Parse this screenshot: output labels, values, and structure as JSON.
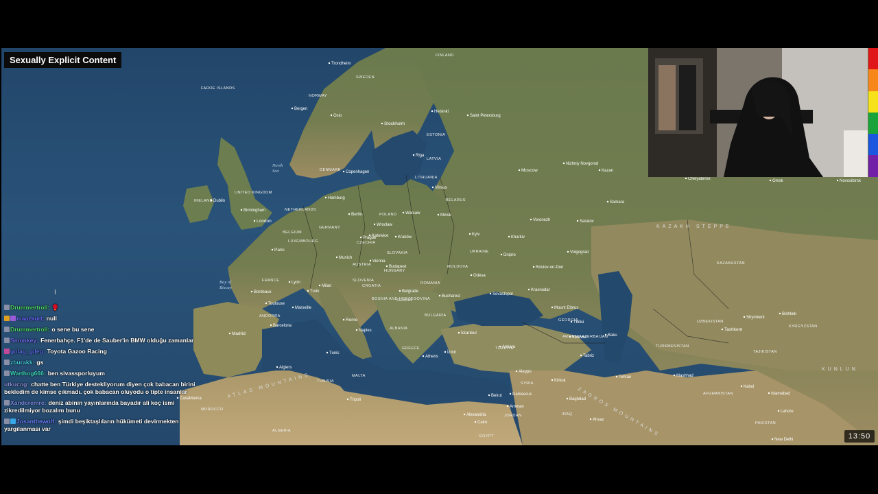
{
  "overlay": {
    "warning_label": "Sexually Explicit Content"
  },
  "clock": "13:50",
  "map": {
    "cities": [
      {
        "id": "trondheim",
        "name": "Trondheim"
      },
      {
        "id": "bergen",
        "name": "Bergen"
      },
      {
        "id": "oslo",
        "name": "Oslo"
      },
      {
        "id": "stockholm",
        "name": "Stockholm"
      },
      {
        "id": "helsinki",
        "name": "Helsinki"
      },
      {
        "id": "stpetersburg",
        "name": "Saint Petersburg"
      },
      {
        "id": "copenhagen",
        "name": "Copenhagen"
      },
      {
        "id": "riga",
        "name": "Riga"
      },
      {
        "id": "vilnius",
        "name": "Vilnius"
      },
      {
        "id": "moscow",
        "name": "Moscow"
      },
      {
        "id": "nizhny",
        "name": "Nizhniy Novgorod"
      },
      {
        "id": "kazan",
        "name": "Kazan"
      },
      {
        "id": "samara",
        "name": "Samara"
      },
      {
        "id": "saratov",
        "name": "Saratov"
      },
      {
        "id": "voronezh",
        "name": "Voronezh"
      },
      {
        "id": "kharkiv",
        "name": "Kharkiv"
      },
      {
        "id": "kyiv",
        "name": "Kyiv"
      },
      {
        "id": "dnipro",
        "name": "Dnipro"
      },
      {
        "id": "volgograd",
        "name": "Volgograd"
      },
      {
        "id": "rostov",
        "name": "Rostov-on-Don"
      },
      {
        "id": "odesa",
        "name": "Odesa"
      },
      {
        "id": "krasnodar",
        "name": "Krasnodar"
      },
      {
        "id": "sevastopol",
        "name": "Sevastopol"
      },
      {
        "id": "minsk",
        "name": "Minsk"
      },
      {
        "id": "warsaw",
        "name": "Warsaw"
      },
      {
        "id": "wroclaw",
        "name": "Wroclaw"
      },
      {
        "id": "krakow",
        "name": "Kraków"
      },
      {
        "id": "katowice",
        "name": "Katowice"
      },
      {
        "id": "berlin",
        "name": "Berlin"
      },
      {
        "id": "hamburg",
        "name": "Hamburg"
      },
      {
        "id": "prague",
        "name": "Prague"
      },
      {
        "id": "munich",
        "name": "Munich"
      },
      {
        "id": "vienna",
        "name": "Vienna"
      },
      {
        "id": "budapest",
        "name": "Budapest"
      },
      {
        "id": "belgrade",
        "name": "Belgrade"
      },
      {
        "id": "bucharest",
        "name": "Bucharest"
      },
      {
        "id": "milan",
        "name": "Milan"
      },
      {
        "id": "turin",
        "name": "Turin"
      },
      {
        "id": "rome",
        "name": "Rome"
      },
      {
        "id": "naples",
        "name": "Naples"
      },
      {
        "id": "marseille",
        "name": "Marseille"
      },
      {
        "id": "lyon",
        "name": "Lyon"
      },
      {
        "id": "paris",
        "name": "Paris"
      },
      {
        "id": "bordeaux",
        "name": "Bordeaux"
      },
      {
        "id": "toulouse",
        "name": "Toulouse"
      },
      {
        "id": "london",
        "name": "London"
      },
      {
        "id": "birmingham",
        "name": "Birmingham"
      },
      {
        "id": "dublin",
        "name": "Dublin"
      },
      {
        "id": "madrid",
        "name": "Madrid"
      },
      {
        "id": "barcelona",
        "name": "Barcelona"
      },
      {
        "id": "algiers",
        "name": "Algiers"
      },
      {
        "id": "tunis",
        "name": "Tunis"
      },
      {
        "id": "tripoli",
        "name": "Tripoli"
      },
      {
        "id": "casablanca",
        "name": "Casablanca"
      },
      {
        "id": "athens",
        "name": "Athens"
      },
      {
        "id": "izmir",
        "name": "İzmir"
      },
      {
        "id": "istanbul",
        "name": "İstanbul"
      },
      {
        "id": "ankara",
        "name": "Ankara"
      },
      {
        "id": "aleppo",
        "name": "Aleppo"
      },
      {
        "id": "damascus",
        "name": "Damascus"
      },
      {
        "id": "beirut",
        "name": "Beirut"
      },
      {
        "id": "amman",
        "name": "Amman"
      },
      {
        "id": "baghdad",
        "name": "Baghdad"
      },
      {
        "id": "cairo",
        "name": "Cairo"
      },
      {
        "id": "alexandria",
        "name": "Alexandria"
      },
      {
        "id": "tehran",
        "name": "Tehran"
      },
      {
        "id": "tabriz",
        "name": "Tabriz"
      },
      {
        "id": "baku",
        "name": "Baku"
      },
      {
        "id": "tbilisi",
        "name": "Tbilisi"
      },
      {
        "id": "yerevan",
        "name": "Yerevan"
      },
      {
        "id": "mashhad",
        "name": "Mashhad"
      },
      {
        "id": "tashkent",
        "name": "Tashkent"
      },
      {
        "id": "bishkek",
        "name": "Bishkek"
      },
      {
        "id": "shymkent",
        "name": "Shymkent"
      },
      {
        "id": "kabul",
        "name": "Kabul"
      },
      {
        "id": "islamabad",
        "name": "Islamabad"
      },
      {
        "id": "lahore",
        "name": "Lahore"
      },
      {
        "id": "newdelhi",
        "name": "New Delhi"
      },
      {
        "id": "omsk",
        "name": "Omsk"
      },
      {
        "id": "novosibirsk",
        "name": "Novosibirsk"
      },
      {
        "id": "chelyabinsk",
        "name": "Chelyabinsk"
      },
      {
        "id": "elbrus",
        "name": "Mount Elbrus"
      },
      {
        "id": "kirkuk",
        "name": "Kirkuk"
      },
      {
        "id": "ahvaz",
        "name": "Ahvaz"
      }
    ],
    "countries": [
      {
        "id": "finland",
        "name": "FINLAND"
      },
      {
        "id": "sweden",
        "name": "SWEDEN"
      },
      {
        "id": "norway",
        "name": "NORWAY"
      },
      {
        "id": "denmark",
        "name": "DENMARK"
      },
      {
        "id": "estonia",
        "name": "ESTONIA"
      },
      {
        "id": "latvia",
        "name": "LATVIA"
      },
      {
        "id": "lithuania",
        "name": "LITHUANIA"
      },
      {
        "id": "belarus",
        "name": "BELARUS"
      },
      {
        "id": "ukraine",
        "name": "UKRAINE"
      },
      {
        "id": "poland",
        "name": "POLAND"
      },
      {
        "id": "germany",
        "name": "GERMANY"
      },
      {
        "id": "netherlands",
        "name": "NETHERLANDS"
      },
      {
        "id": "belgium",
        "name": "BELGIUM"
      },
      {
        "id": "luxembourg",
        "name": "LUXEMBOURG"
      },
      {
        "id": "czechia",
        "name": "CZECHIA"
      },
      {
        "id": "slovakia",
        "name": "SLOVAKIA"
      },
      {
        "id": "austria",
        "name": "AUSTRIA"
      },
      {
        "id": "hungary",
        "name": "HUNGARY"
      },
      {
        "id": "slovenia",
        "name": "SLOVENIA"
      },
      {
        "id": "croatia",
        "name": "CROATIA"
      },
      {
        "id": "bosnia",
        "name": "BOSNIA AND HERZEGOVINA"
      },
      {
        "id": "serbia",
        "name": "SERBIA"
      },
      {
        "id": "romania",
        "name": "ROMANIA"
      },
      {
        "id": "moldova",
        "name": "MOLDOVA"
      },
      {
        "id": "bulgaria",
        "name": "BULGARIA"
      },
      {
        "id": "albania",
        "name": "ALBANIA"
      },
      {
        "id": "greece",
        "name": "GREECE"
      },
      {
        "id": "france",
        "name": "FRANCE"
      },
      {
        "id": "andorra",
        "name": "ANDORRA"
      },
      {
        "id": "uk",
        "name": "UNITED KINGDOM"
      },
      {
        "id": "ireland",
        "name": "IRELAND"
      },
      {
        "id": "faroe",
        "name": "FAROE ISLANDS"
      },
      {
        "id": "tunisia",
        "name": "TUNISIA"
      },
      {
        "id": "malta",
        "name": "MALTA"
      },
      {
        "id": "algeria",
        "name": "ALGERIA"
      },
      {
        "id": "morocco",
        "name": "MOROCCO"
      },
      {
        "id": "turkiye",
        "name": "TÜRKİYE"
      },
      {
        "id": "syria",
        "name": "SYRIA"
      },
      {
        "id": "iraq",
        "name": "IRAQ"
      },
      {
        "id": "jordan",
        "name": "JORDAN"
      },
      {
        "id": "egypt",
        "name": "EGYPT"
      },
      {
        "id": "georgia",
        "name": "GEORGIA"
      },
      {
        "id": "armenia",
        "name": "ARMENIA"
      },
      {
        "id": "azerbaijan",
        "name": "AZERBAIJAN"
      },
      {
        "id": "turkmenistan",
        "name": "TURKMENISTAN"
      },
      {
        "id": "uzbekistan",
        "name": "UZBEKISTAN"
      },
      {
        "id": "kazakhstan",
        "name": "KAZAKHSTAN"
      },
      {
        "id": "kyrgyzstan",
        "name": "KYRGYZSTAN"
      },
      {
        "id": "tajikistan",
        "name": "TAJIKISTAN"
      },
      {
        "id": "afghanistan",
        "name": "AFGHANISTAN"
      },
      {
        "id": "pakistan",
        "name": "PAKISTAN"
      }
    ],
    "seas": [
      {
        "id": "north",
        "name": "North\nSea"
      },
      {
        "id": "biscay",
        "name": "Bay of\nBiscay"
      }
    ],
    "regions": [
      {
        "id": "steppe",
        "name": "KAZAKH STEPPE"
      },
      {
        "id": "atlas",
        "name": "ATLAS MOUNTAINS"
      },
      {
        "id": "zagros",
        "name": "ZAGROS MOUNTAINS"
      },
      {
        "id": "kunlun",
        "name": "KUNLUN"
      }
    ]
  },
  "chat": [
    {
      "user": "Drummertroll",
      "user_color": "#4fd66b",
      "text": "🥊",
      "badges": [
        "#8a8fa8"
      ]
    },
    {
      "user": "maazkurt",
      "user_color": "#6b6bff",
      "text": "null",
      "badges": [
        "#e0a020",
        "#9a5bd6"
      ]
    },
    {
      "user": "Drummertroll",
      "user_color": "#4fd66b",
      "text": "o sene bu sene",
      "badges": [
        "#8a8fa8"
      ]
    },
    {
      "user": "Smonkey",
      "user_color": "#6f6ff0",
      "text": "Fenerbahçe. F1'de de Sauber'in BMW olduğu zamanlar",
      "badges": [
        "#8a8fa8"
      ]
    },
    {
      "user": "gölag_gileg",
      "user_color": "#5a6fe8",
      "text": "Toyota Gazoo Racing",
      "badges": [
        "#c04a9a"
      ]
    },
    {
      "user": "zburakk",
      "user_color": "#42c8d8",
      "text": "gs",
      "badges": [
        "#8a8fa8"
      ]
    },
    {
      "user": "Warthog666",
      "user_color": "#3ed8c0",
      "text": "ben sivassporluyum",
      "badges": [
        "#8a8fa8"
      ]
    },
    {
      "user": "utkucng",
      "user_color": "#8a8fd8",
      "text": "chatte ben Türkiye destekliyorum diyen çok babacan birini bekledim de kimse çıkmadı. çok babacan oluyodu o tipte insanlar",
      "badges": []
    },
    {
      "user": "Xanderemre",
      "user_color": "#7a8fe8",
      "text": "deniz abinin yayınlarında bayadır ali koç ismi zikredilmiyor bozalım bunu",
      "badges": [
        "#8a8fa8"
      ]
    },
    {
      "user": "Josanthewolf",
      "user_color": "#6a7fff",
      "text": "şimdi beşiktaşlıların hükümeti devirmekten yargılanması var",
      "badges": [
        "#8a8fa8",
        "#38a8e8"
      ]
    }
  ],
  "colors": {
    "ocean": "#24486c",
    "land": "#66774b",
    "desert": "#a89468",
    "pride": [
      "#e0161a",
      "#f7861b",
      "#f7e11b",
      "#19a33a",
      "#1b55e0",
      "#7220a8"
    ]
  }
}
